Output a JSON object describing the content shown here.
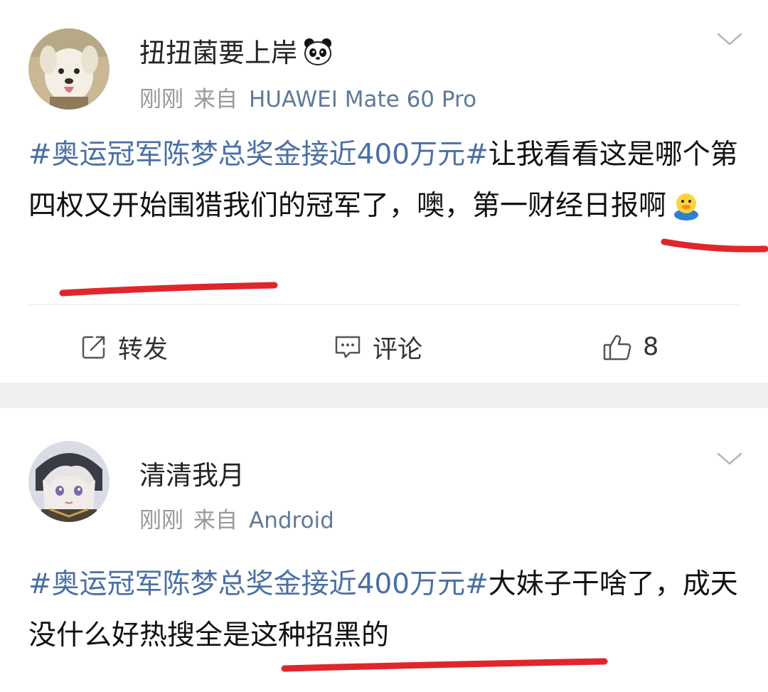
{
  "posts": [
    {
      "username": "扭扭菌要上岸",
      "time": "刚刚",
      "from_label": "来自",
      "device": "HUAWEI Mate 60 Pro",
      "topic": "#奥运冠军陈梦总奖金接近400万元#",
      "text": "让我看看这是哪个第四权又开始围猎我们的冠军了，噢，第一财经日报啊",
      "name_icon": "panda-icon",
      "trailing_icon": "duck-emoji-icon",
      "actions": {
        "repost": "转发",
        "comment": "评论",
        "likes": "8"
      }
    },
    {
      "username": "清清我月",
      "time": "刚刚",
      "from_label": "来自",
      "device": "Android",
      "topic": "#奥运冠军陈梦总奖金接近400万元#",
      "text": "大妹子干啥了，成天没什么好热搜全是这种招黑的"
    }
  ],
  "colors": {
    "topic_link": "#4a6fa5",
    "device_link": "#5f7a98",
    "meta_gray": "#999999",
    "separator": "#eef0f2",
    "annotation_red": "#e0262b"
  }
}
